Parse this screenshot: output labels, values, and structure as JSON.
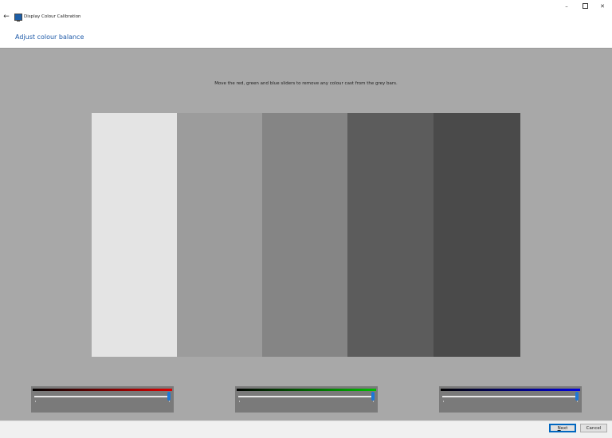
{
  "window": {
    "title": "Display Colour Calibration",
    "back_glyph": "←",
    "minimize_glyph": "–",
    "close_glyph": "✕",
    "icons": {
      "back": "back-arrow-icon",
      "app": "display-calibration-icon",
      "minimize": "minimize-icon",
      "maximize": "maximize-icon",
      "close": "close-icon"
    }
  },
  "page": {
    "heading": "Adjust colour balance",
    "instruction": "Move the red, green and blue sliders to remove any colour cast from the grey bars."
  },
  "grey_bars": [
    {
      "color": "#e4e4e4",
      "width_fraction": 0.199
    },
    {
      "color": "#9c9c9c",
      "width_fraction": 0.199
    },
    {
      "color": "#858585",
      "width_fraction": 0.199
    },
    {
      "color": "#5c5c5c",
      "width_fraction": 0.201
    },
    {
      "color": "#4a4a4a",
      "width_fraction": 0.202
    }
  ],
  "sliders": [
    {
      "channel": "red",
      "color": "#e00000",
      "value": 0.99
    },
    {
      "channel": "green",
      "color": "#00c000",
      "value": 0.99
    },
    {
      "channel": "blue",
      "color": "#0000e0",
      "value": 0.99
    }
  ],
  "colors": {
    "accent": "#1e78d6",
    "heading": "#1e5aa8",
    "calibration_background": "#a8a8a8"
  },
  "buttons": {
    "next_prefix": "",
    "next_mnemonic": "N",
    "next_rest": "ext",
    "cancel": "Cancel"
  }
}
